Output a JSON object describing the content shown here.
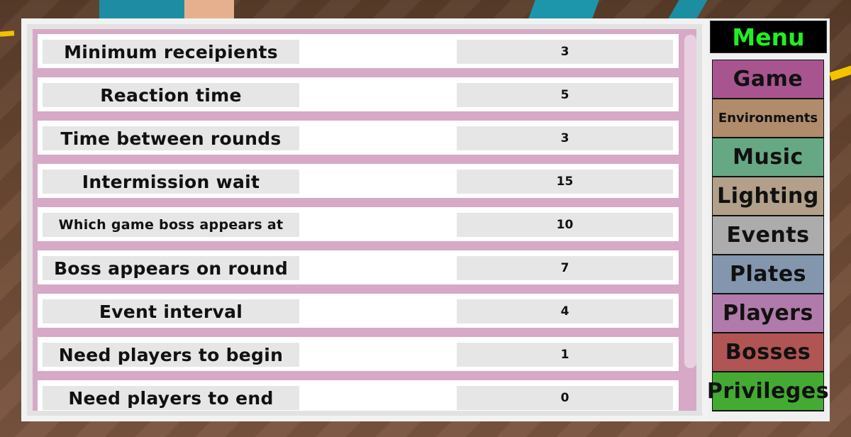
{
  "settings": {
    "rows": [
      {
        "label": "Minimum receipients",
        "value": "3"
      },
      {
        "label": "Reaction time",
        "value": "5"
      },
      {
        "label": "Time between rounds",
        "value": "3"
      },
      {
        "label": "Intermission wait",
        "value": "15"
      },
      {
        "label": "Which game boss appears at",
        "value": "10"
      },
      {
        "label": "Boss appears on round",
        "value": "7"
      },
      {
        "label": "Event interval",
        "value": "4"
      },
      {
        "label": "Need players to begin",
        "value": "1"
      },
      {
        "label": "Need players to end",
        "value": "0"
      }
    ]
  },
  "menu": {
    "title": "Menu",
    "title_color": "#22ee22",
    "items": [
      {
        "label": "Game",
        "color": "#a8558f"
      },
      {
        "label": "Environments",
        "color": "#b08b6c"
      },
      {
        "label": "Music",
        "color": "#67a884"
      },
      {
        "label": "Lighting",
        "color": "#b2a08a"
      },
      {
        "label": "Events",
        "color": "#acacac"
      },
      {
        "label": "Plates",
        "color": "#8496ae"
      },
      {
        "label": "Players",
        "color": "#b07aab"
      },
      {
        "label": "Bosses",
        "color": "#b05454"
      },
      {
        "label": "Privileges",
        "color": "#44aa33"
      }
    ]
  }
}
